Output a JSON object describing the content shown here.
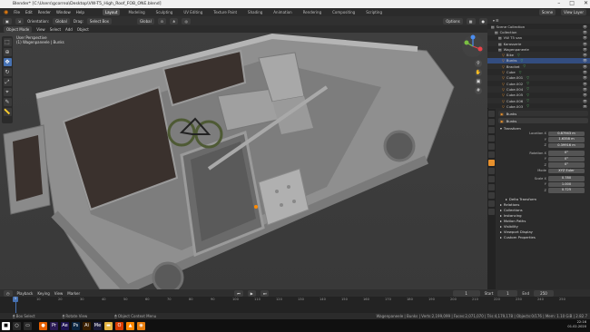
{
  "window": {
    "title": "Blender* [C:\\Users\\gcorrea\\Desktop\\VW-T5_High_Roof_FOB_ONE.blend]"
  },
  "menu": {
    "items": [
      "File",
      "Edit",
      "Render",
      "Window",
      "Help"
    ],
    "workspaces": [
      "Layout",
      "Modeling",
      "Sculpting",
      "UV Editing",
      "Texture Paint",
      "Shading",
      "Animation",
      "Rendering",
      "Compositing",
      "Scripting"
    ],
    "active_workspace": "Layout",
    "scene": "Scene",
    "view_layer": "View Layer"
  },
  "header3d": {
    "orientation_label": "Orientation:",
    "orientation_value": "Global",
    "drag_label": "Drag:",
    "drag_value": "Select Box",
    "transform": "Global",
    "options": "Options"
  },
  "viewport_menu": {
    "mode": "Object Mode",
    "items": [
      "View",
      "Select",
      "Add",
      "Object"
    ]
  },
  "overlay": {
    "view_name": "User Perspective",
    "collection_info": "(1) Wagenpaneele | Bunks"
  },
  "outliner": {
    "rows": [
      {
        "label": "Scene Collection",
        "indent": 0,
        "vert": ""
      },
      {
        "label": "Collection",
        "indent": 1,
        "vert": ""
      },
      {
        "label": "VW T5 van",
        "indent": 2,
        "vert": ""
      },
      {
        "label": "Karosserie",
        "indent": 2,
        "vert": ""
      },
      {
        "label": "Wagenpaneele",
        "indent": 2,
        "vert": ""
      },
      {
        "label": "Bike",
        "indent": 3,
        "vert": "▽"
      },
      {
        "label": "Bunks",
        "indent": 3,
        "vert": "▽",
        "selected": true
      },
      {
        "label": "Bracket",
        "indent": 3,
        "vert": "▽"
      },
      {
        "label": "Cube",
        "indent": 3,
        "vert": "▽"
      },
      {
        "label": "Cube.001",
        "indent": 3,
        "vert": "▽"
      },
      {
        "label": "Cube.002",
        "indent": 3,
        "vert": "▽"
      },
      {
        "label": "Cube.004",
        "indent": 3,
        "vert": "▽"
      },
      {
        "label": "Cube.005",
        "indent": 3,
        "vert": "▽"
      },
      {
        "label": "Cube.006",
        "indent": 3,
        "vert": "▽"
      },
      {
        "label": "Cube.003",
        "indent": 3,
        "vert": "▽"
      }
    ]
  },
  "properties": {
    "object_name": "Bunks",
    "data_name": "Bunks",
    "transform_label": "Transform",
    "location": {
      "label": "Location X",
      "x": "0.87943 m",
      "y": "1.6358 m",
      "z": "0.39916 m"
    },
    "rotation": {
      "label": "Rotation X",
      "x": "0°",
      "y": "0°",
      "z": "0°"
    },
    "mode": {
      "label": "Mode",
      "value": "XYZ Euler"
    },
    "scale": {
      "label": "Scale X",
      "x": "0.780",
      "y": "1.000",
      "z": "0.725"
    },
    "sections": [
      "Delta Transform",
      "Relations",
      "Collections",
      "Instancing",
      "Motion Paths",
      "Visibility",
      "Viewport Display",
      "Custom Properties"
    ]
  },
  "timeline": {
    "menu": [
      "Playback",
      "Keying",
      "View",
      "Marker"
    ],
    "current_frame": "1",
    "start_label": "Start",
    "start": "1",
    "end_label": "End",
    "end": "250",
    "ticks": [
      "0",
      "10",
      "20",
      "30",
      "40",
      "50",
      "60",
      "70",
      "80",
      "90",
      "100",
      "110",
      "120",
      "130",
      "140",
      "150",
      "160",
      "170",
      "180",
      "190",
      "200",
      "210",
      "220",
      "230",
      "240",
      "250"
    ]
  },
  "status": {
    "items": [
      "Box Select",
      "Rotate View",
      "Object Context Menu"
    ],
    "stats": "Wagenpaneele | Bunks | Verts:2,199,099 | Faces:2,071,070 | Tris:4,179,178 | Objects:0/176 | Mem: 1.10 GiB | 2.82.7"
  },
  "taskbar": {
    "time": "22:16",
    "date": "01.02.2020",
    "apps": [
      {
        "name": "windows-start-icon",
        "color": "#ffffff",
        "glyph": "■"
      },
      {
        "name": "search-icon",
        "color": "#2a2a2a",
        "glyph": "○"
      },
      {
        "name": "task-view-icon",
        "color": "#2a2a2a",
        "glyph": "▭"
      },
      {
        "name": "firefox-icon",
        "color": "#e66000",
        "glyph": "●"
      },
      {
        "name": "premiere-icon",
        "color": "#2a1a54",
        "glyph": "Pr"
      },
      {
        "name": "after-effects-icon",
        "color": "#1f1452",
        "glyph": "Ae"
      },
      {
        "name": "photoshop-icon",
        "color": "#0b2540",
        "glyph": "Ps"
      },
      {
        "name": "illustrator-icon",
        "color": "#3b2000",
        "glyph": "Ai"
      },
      {
        "name": "media-encoder-icon",
        "color": "#1c1c3a",
        "glyph": "Me"
      },
      {
        "name": "explorer-icon",
        "color": "#e3b341",
        "glyph": "▬"
      },
      {
        "name": "office-icon",
        "color": "#d83b01",
        "glyph": "O"
      },
      {
        "name": "vlc-icon",
        "color": "#ff8800",
        "glyph": "▲"
      },
      {
        "name": "blender-icon",
        "color": "#e87d0d",
        "glyph": "◉"
      }
    ]
  }
}
